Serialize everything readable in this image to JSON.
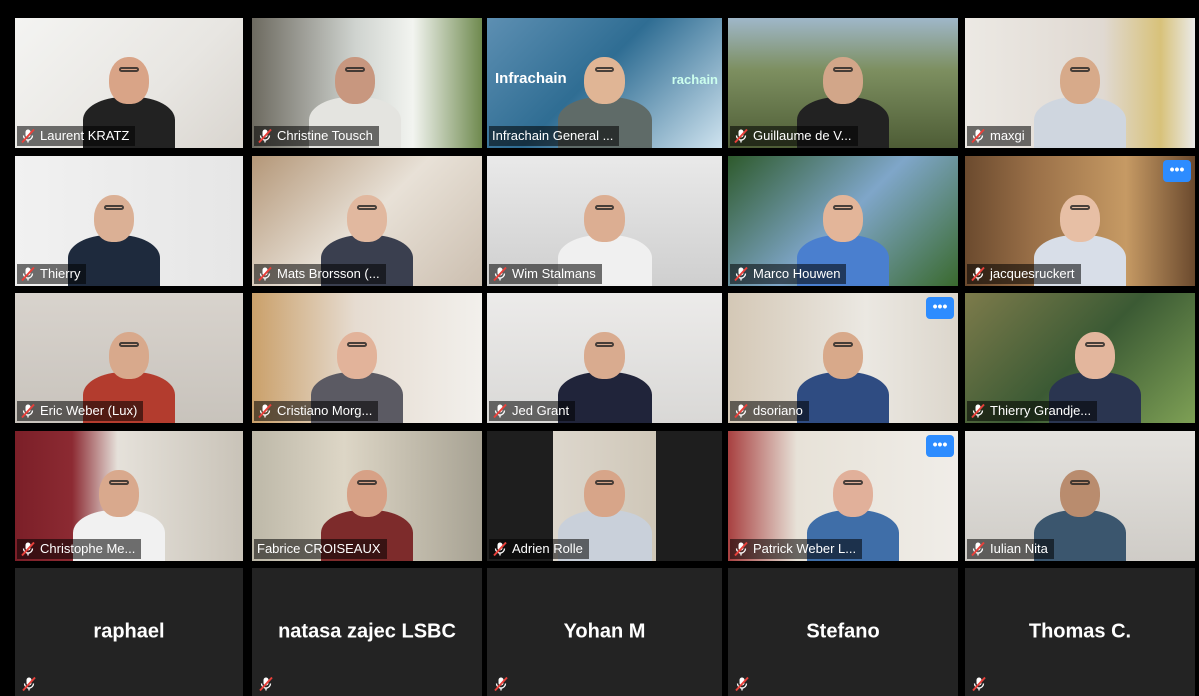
{
  "app": {
    "active_speaker_color": "#d7dd48",
    "accent": "#2d8cff",
    "muted_mic_color": "#e8403a"
  },
  "icons": {
    "muted": "mic-off-icon",
    "more": "more-options-icon"
  },
  "more_button_label": "•••",
  "participants": [
    {
      "name": "Laurent KRATZ",
      "muted": true
    },
    {
      "name": "Christine Tousch",
      "muted": true
    },
    {
      "name": "Infrachain General ...",
      "muted": false,
      "active": true,
      "brand_text": "Infrachain",
      "brand_text_2": "rachain"
    },
    {
      "name": "Guillaume de V...",
      "muted": true
    },
    {
      "name": "maxgi",
      "muted": true
    },
    {
      "name": "Thierry",
      "muted": true
    },
    {
      "name": "Mats Brorsson (...",
      "muted": true
    },
    {
      "name": "Wim Stalmans",
      "muted": true
    },
    {
      "name": "Marco Houwen",
      "muted": true
    },
    {
      "name": "jacquesruckert",
      "muted": true,
      "more": true
    },
    {
      "name": "Eric Weber (Lux)",
      "muted": true
    },
    {
      "name": "Cristiano Morg...",
      "muted": true
    },
    {
      "name": "Jed Grant",
      "muted": true
    },
    {
      "name": "dsoriano",
      "muted": true,
      "more": true
    },
    {
      "name": "Thierry Grandje...",
      "muted": true
    },
    {
      "name": "Christophe Me...",
      "muted": true
    },
    {
      "name": "Fabrice CROISEAUX",
      "muted": false
    },
    {
      "name": "Adrien Rolle",
      "muted": true
    },
    {
      "name": "Patrick Weber L...",
      "muted": true,
      "more": true
    },
    {
      "name": "Iulian Nita",
      "muted": true
    },
    {
      "name": "raphael",
      "muted": true,
      "video_off": true
    },
    {
      "name": "natasa zajec LSBC",
      "muted": true,
      "video_off": true
    },
    {
      "name": "Yohan M",
      "muted": true,
      "video_off": true
    },
    {
      "name": "Stefano",
      "muted": true,
      "video_off": true
    },
    {
      "name": "Thomas C.",
      "muted": true,
      "video_off": true
    }
  ]
}
